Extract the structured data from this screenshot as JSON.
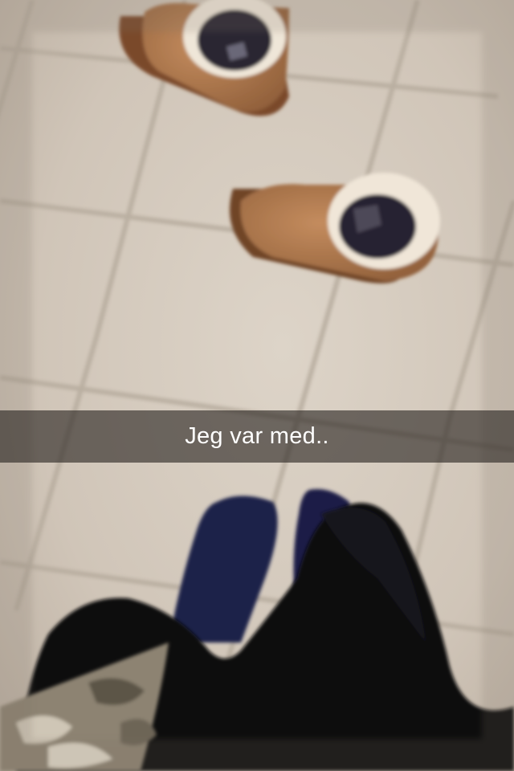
{
  "snap": {
    "caption": "Jeg var med..",
    "caption_bar_color": "#28241f",
    "caption_text_color": "#ffffff"
  },
  "scene": {
    "floor_color": "#d3c9bd",
    "grout_color": "#b8ad9f",
    "boot_color": "#b07a50",
    "boot_lining_color": "#efe5d6",
    "sock_color": "#1c2247",
    "pants_color": "#0b0a0f",
    "camo_color": "#8a8070"
  }
}
